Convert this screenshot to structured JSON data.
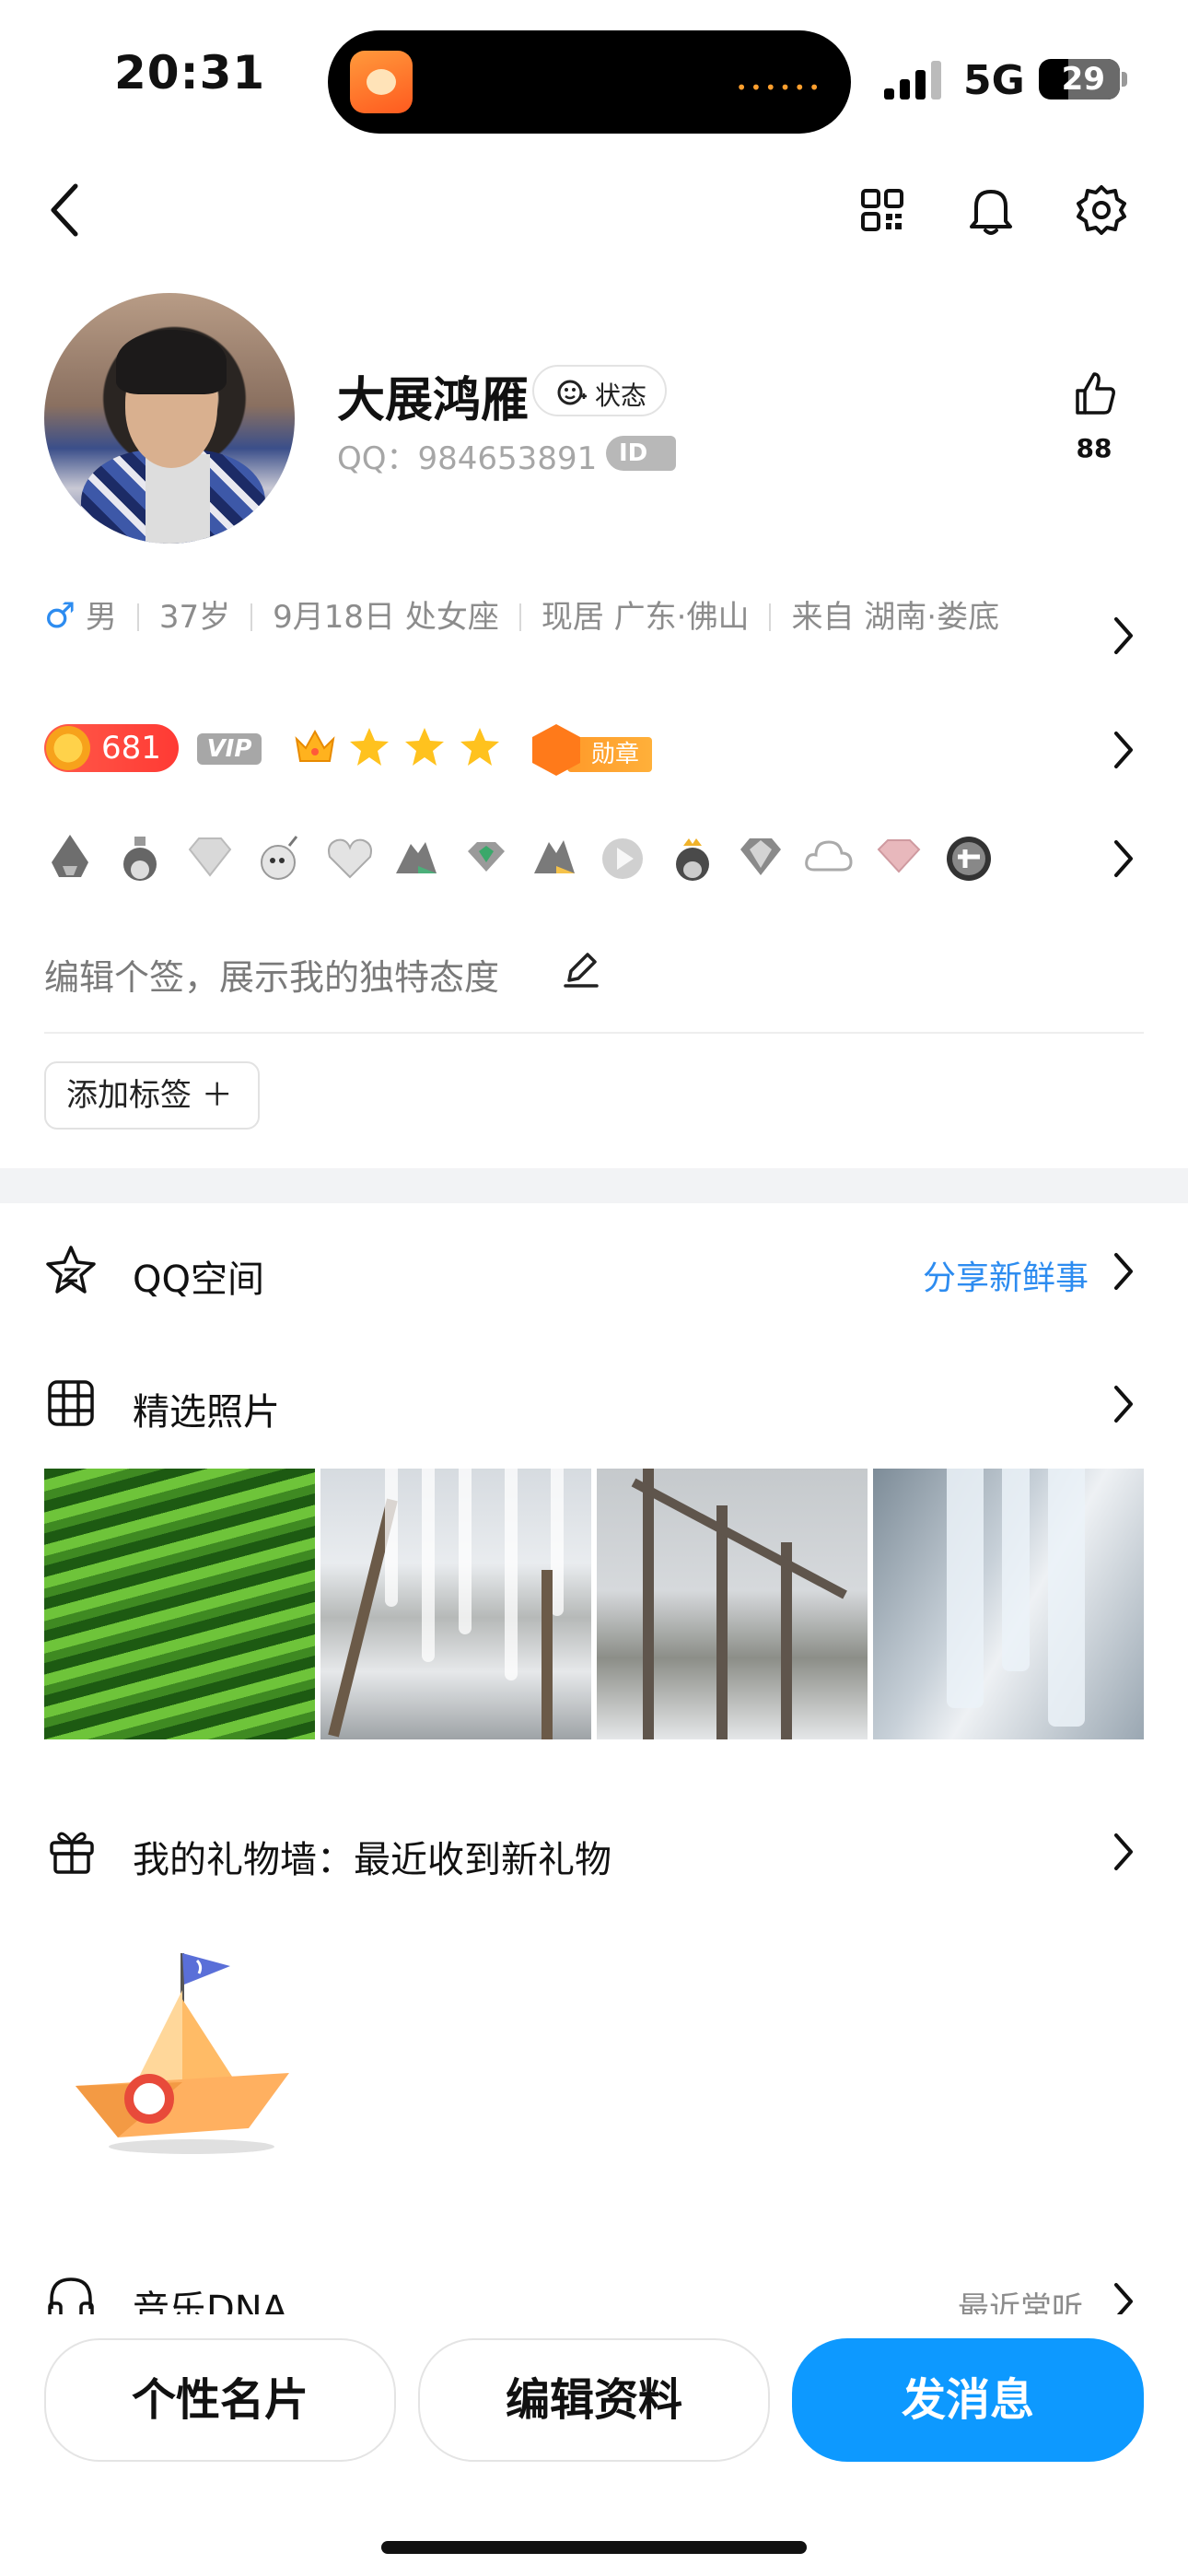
{
  "status_bar": {
    "time": "20:31",
    "network": "5G",
    "battery": "29"
  },
  "profile": {
    "nickname": "大展鸿雁",
    "status_label": "状态",
    "qq_number": "QQ：984653891",
    "id_badge": "ID",
    "likes": "88",
    "info": {
      "gender_symbol": "♂",
      "gender": "男",
      "age": "37岁",
      "birthday": "9月18日 处女座",
      "residence": "现居 广东·佛山",
      "hometown": "来自 湖南·娄底"
    },
    "level_score": "681",
    "vip_label": "VIP",
    "medal_label": "勋章",
    "signature_placeholder": "编辑个签，展示我的独特态度",
    "add_tag_label": "添加标签 ＋"
  },
  "sections": {
    "qzone": {
      "title": "QQ空间",
      "link": "分享新鲜事"
    },
    "photos": {
      "title": "精选照片"
    },
    "gifts": {
      "title": "我的礼物墙：最近收到新礼物"
    },
    "music": {
      "title": "音乐DNA",
      "sub": "最近常听"
    }
  },
  "bottom_buttons": {
    "card": "个性名片",
    "edit": "编辑资料",
    "message": "发消息"
  },
  "colors": {
    "accent": "#0d99ff",
    "link": "#2d8cf0",
    "gender": "#2d8cf0",
    "coin": "#ff3a34",
    "medal": "#ff8a1f"
  },
  "icons": [
    "back-icon",
    "qr-code-icon",
    "bell-icon",
    "settings-icon",
    "like-icon",
    "status-icon",
    "edit-pencil-icon",
    "qzone-star-icon",
    "grid-icon",
    "gift-icon",
    "headphones-icon"
  ]
}
